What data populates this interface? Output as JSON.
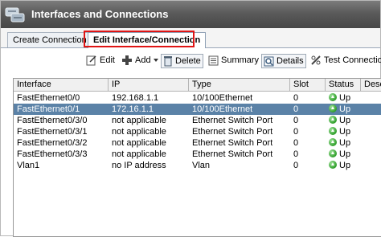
{
  "window": {
    "title": "Interfaces and Connections",
    "icon": "router-interfaces-icon"
  },
  "tabs": [
    {
      "label": "Create Connection",
      "active": false
    },
    {
      "label": "Edit Interface/Connection",
      "active": true
    }
  ],
  "toolbar": {
    "edit_label": "Edit",
    "add_label": "Add",
    "delete_label": "Delete",
    "summary_label": "Summary",
    "details_label": "Details",
    "test_label": "Test Connection"
  },
  "table": {
    "columns": [
      "Interface",
      "IP",
      "Type",
      "Slot",
      "Status",
      "Description"
    ],
    "rows": [
      {
        "interface": "FastEthernet0/0",
        "ip": "192.168.1.1",
        "type": "10/100Ethernet",
        "slot": "0",
        "status": "Up",
        "selected": false
      },
      {
        "interface": "FastEthernet0/1",
        "ip": "172.16.1.1",
        "type": "10/100Ethernet",
        "slot": "0",
        "status": "Up",
        "selected": true
      },
      {
        "interface": "FastEthernet0/3/0",
        "ip": "not applicable",
        "type": "Ethernet Switch Port",
        "slot": "0",
        "status": "Up",
        "selected": false
      },
      {
        "interface": "FastEthernet0/3/1",
        "ip": "not applicable",
        "type": "Ethernet Switch Port",
        "slot": "0",
        "status": "Up",
        "selected": false
      },
      {
        "interface": "FastEthernet0/3/2",
        "ip": "not applicable",
        "type": "Ethernet Switch Port",
        "slot": "0",
        "status": "Up",
        "selected": false
      },
      {
        "interface": "FastEthernet0/3/3",
        "ip": "not applicable",
        "type": "Ethernet Switch Port",
        "slot": "0",
        "status": "Up",
        "selected": false
      },
      {
        "interface": "Vlan1",
        "ip": "no IP address",
        "type": "Vlan",
        "slot": "0",
        "status": "Up",
        "selected": false
      }
    ]
  },
  "colors": {
    "titlebar": "#5a5a5a",
    "selected_row": "#5b82a7",
    "tab_highlight": "#e01414",
    "status_up": "#2f9e2a"
  }
}
